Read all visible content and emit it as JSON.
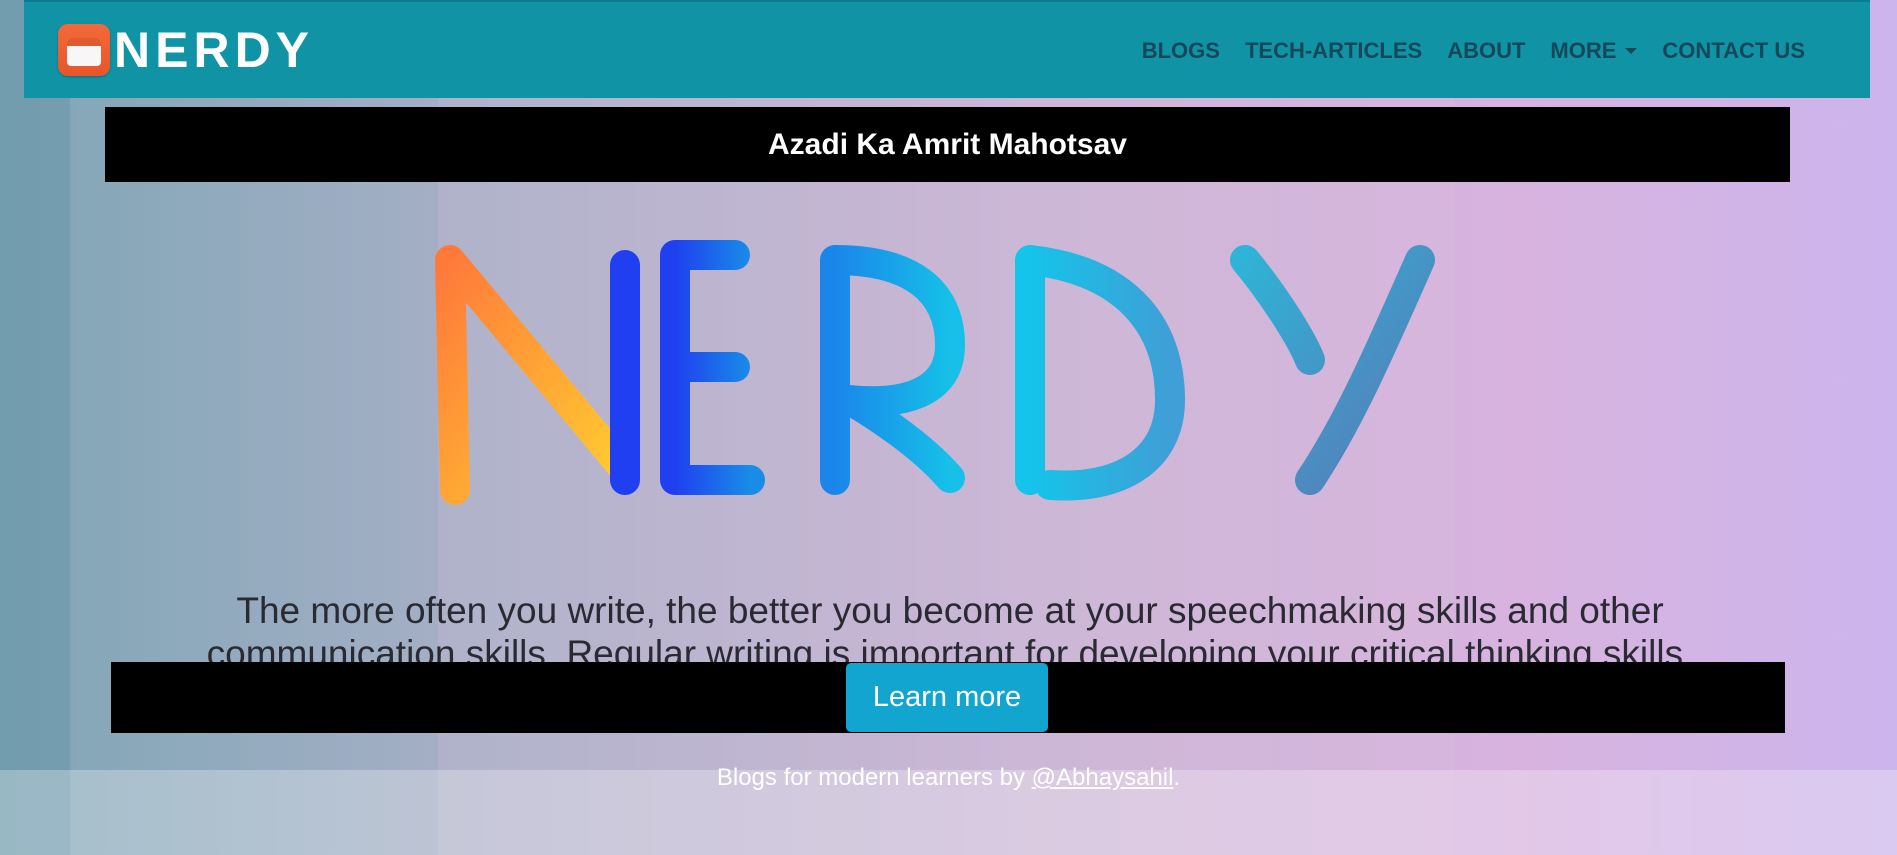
{
  "navbar": {
    "brand_name": "NERDY",
    "links": {
      "blogs": "BLOGS",
      "tech_articles": "TECH-ARTICLES",
      "about": "ABOUT",
      "more": "MORE",
      "contact": "CONTACT US"
    }
  },
  "banner": {
    "text": "Azadi Ka Amrit Mahotsav"
  },
  "hero": {
    "logo_text": "NERDY",
    "tagline": "The more often you write, the better you become at your speechmaking skills and other communication skills. Regular writing is important for developing your critical thinking skills."
  },
  "cta": {
    "label": "Learn more"
  },
  "footer": {
    "lead": "Blogs for modern learners by ",
    "link": "@Abhaysahil",
    "trail": "."
  },
  "colors": {
    "navbar": "#1193a6",
    "nav_link": "#15485a",
    "cta_button": "#12a5cf",
    "banner": "#000000"
  },
  "icons": {
    "brand": "notepad-icon",
    "more_dropdown": "caret-down-icon"
  }
}
